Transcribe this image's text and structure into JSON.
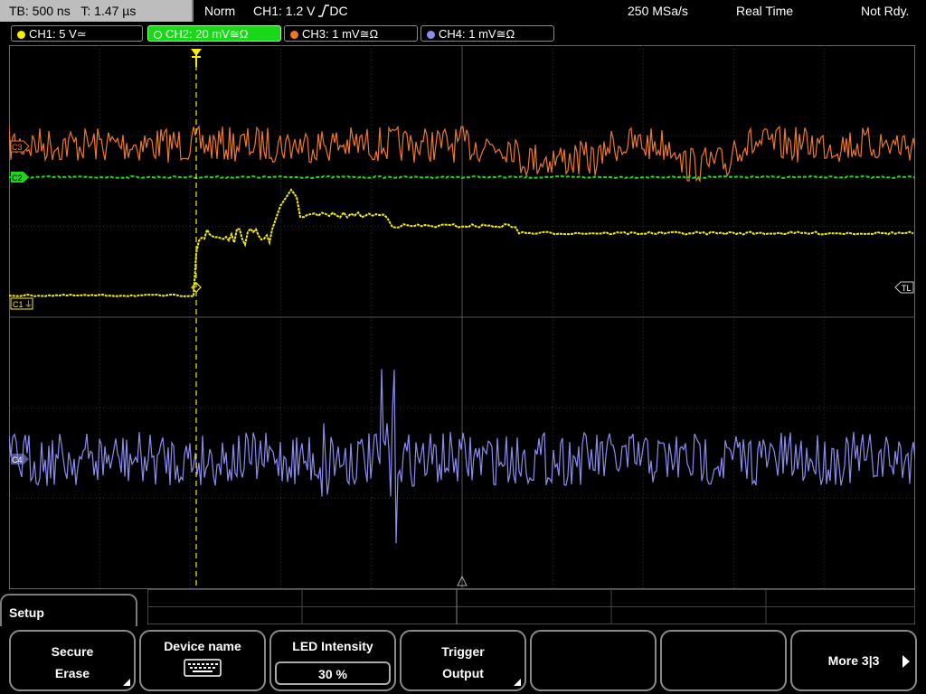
{
  "topbar": {
    "timebase": "TB: 500 ns",
    "trigger_time": "T: 1.47 µs",
    "mode": "Norm",
    "trigger_source": "CH1: 1.2 V",
    "trigger_coupling": "DC",
    "sample_rate": "250 MSa/s",
    "acq_mode": "Real Time",
    "status": "Not Rdy."
  },
  "channels": [
    {
      "label": "CH1: 5 V",
      "coupling": "≃",
      "color": "#f5f000",
      "active": false
    },
    {
      "label": "CH2: 20 mV",
      "coupling": "≅Ω",
      "color": "#19d819",
      "active": true
    },
    {
      "label": "CH3: 1 mV",
      "coupling": "≅Ω",
      "color": "#f07820",
      "active": false
    },
    {
      "label": "CH4: 1 mV",
      "coupling": "≅Ω",
      "color": "#8c8cf0",
      "active": false
    }
  ],
  "markers": {
    "ch3": "C3",
    "ch2": "C2",
    "ch1": "C1",
    "ch4": "C4",
    "trigger_level": "TL",
    "trigger_pos": "T"
  },
  "setup_tab": "Setup",
  "softkeys": [
    {
      "line1": "Secure",
      "line2": "Erase",
      "icon": "menu-corner"
    },
    {
      "line1": "Device name",
      "icon": "keyboard-icon"
    },
    {
      "line1": "LED Intensity",
      "value": "30 %"
    },
    {
      "line1": "Trigger",
      "line2": "Output",
      "icon": "menu-corner"
    },
    {
      "line1": ""
    },
    {
      "line1": ""
    },
    {
      "line1": "More 3|3",
      "icon": "arrow-right-icon"
    }
  ]
}
